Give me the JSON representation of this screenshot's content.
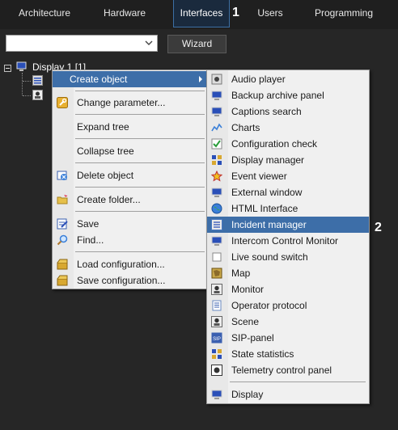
{
  "tabs": [
    {
      "label": "Architecture"
    },
    {
      "label": "Hardware"
    },
    {
      "label": "Interfaces",
      "active": true
    },
    {
      "label": "Users"
    },
    {
      "label": "Programming"
    }
  ],
  "callouts": {
    "first": "1",
    "second": "2"
  },
  "toolbar": {
    "combo_value": "",
    "wizard_label": "Wizard"
  },
  "tree": {
    "root_label": "Display 1 [1]"
  },
  "context_menu": {
    "items": [
      {
        "label": "Create object",
        "icon": "none",
        "highlighted": true,
        "submenu": true
      },
      {
        "label": "Change parameter...",
        "icon": "wrench-icon"
      },
      {
        "label": "Expand tree",
        "icon": "none"
      },
      {
        "label": "Collapse tree",
        "icon": "none"
      },
      {
        "label": "Delete object",
        "icon": "delete-icon"
      },
      {
        "label": "Create folder...",
        "icon": "folder-icon"
      },
      {
        "label": "Save",
        "icon": "save-icon"
      },
      {
        "label": "Find...",
        "icon": "magnifier-icon"
      },
      {
        "label": "Load configuration...",
        "icon": "box-icon"
      },
      {
        "label": "Save configuration...",
        "icon": "box-icon"
      }
    ]
  },
  "submenu": {
    "items": [
      {
        "label": "Audio player",
        "icon": "speaker-icon"
      },
      {
        "label": "Backup archive panel",
        "icon": "monitor-icon"
      },
      {
        "label": "Captions search",
        "icon": "monitor-icon"
      },
      {
        "label": "Charts",
        "icon": "chart-icon"
      },
      {
        "label": "Configuration check",
        "icon": "check-icon"
      },
      {
        "label": "Display manager",
        "icon": "grid-icon"
      },
      {
        "label": "Event viewer",
        "icon": "star-icon"
      },
      {
        "label": "External window",
        "icon": "monitor-icon"
      },
      {
        "label": "HTML Interface",
        "icon": "globe-icon"
      },
      {
        "label": "Incident manager",
        "icon": "list-icon",
        "highlighted": true
      },
      {
        "label": "Intercom Control Monitor",
        "icon": "monitor-icon"
      },
      {
        "label": "Live sound switch",
        "icon": "square-icon"
      },
      {
        "label": "Map",
        "icon": "map-icon"
      },
      {
        "label": "Monitor",
        "icon": "camera-icon"
      },
      {
        "label": "Operator protocol",
        "icon": "document-icon"
      },
      {
        "label": "Scene",
        "icon": "camera-icon"
      },
      {
        "label": "SIP-panel",
        "icon": "sip-icon"
      },
      {
        "label": "State statistics",
        "icon": "grid-icon"
      },
      {
        "label": "Telemetry control panel",
        "icon": "telemetry-icon"
      },
      {
        "label": "Display",
        "icon": "monitor-icon"
      }
    ]
  }
}
